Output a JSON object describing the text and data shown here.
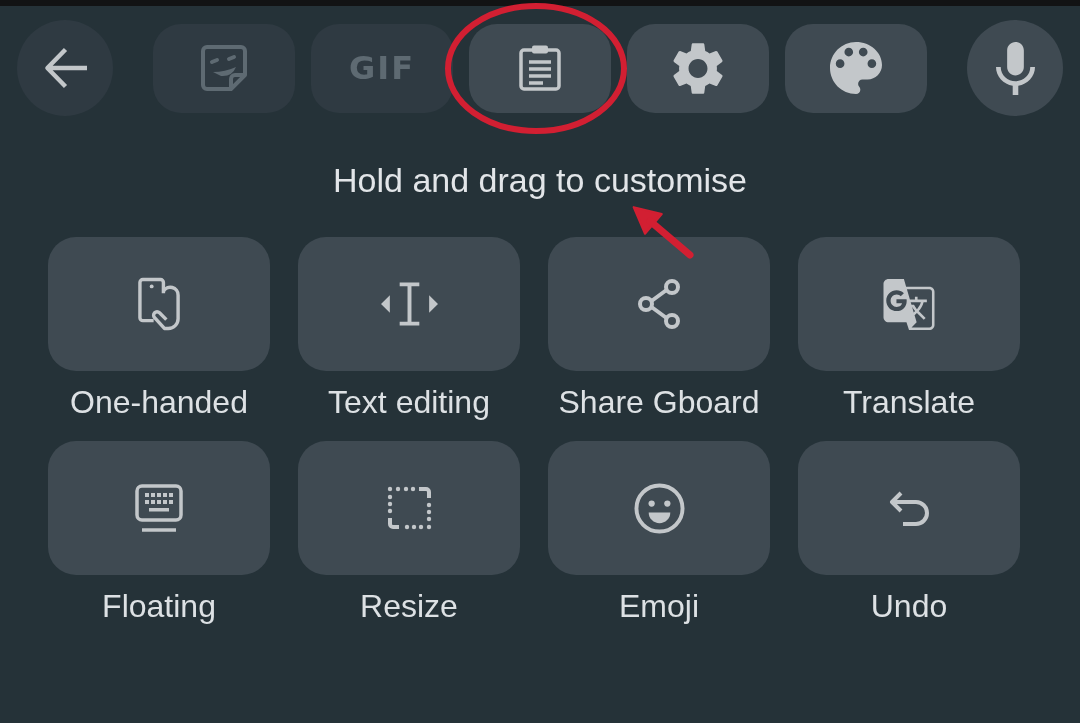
{
  "toolbar": {
    "items": [
      {
        "kind": "back",
        "disabled": false,
        "circled": false
      },
      {
        "kind": "tile",
        "disabled": true,
        "circled": false
      },
      {
        "kind": "tile",
        "label": "GIF",
        "disabled": true,
        "circled": false
      },
      {
        "kind": "tile",
        "disabled": false,
        "circled": true
      },
      {
        "kind": "tile",
        "disabled": false,
        "circled": false
      },
      {
        "kind": "tile",
        "disabled": false,
        "circled": false
      },
      {
        "kind": "round",
        "disabled": false,
        "circled": false
      }
    ]
  },
  "hint": "Hold and drag to customise",
  "tools": [
    {
      "label": "One-handed"
    },
    {
      "label": "Text editing"
    },
    {
      "label": "Share Gboard"
    },
    {
      "label": "Translate"
    },
    {
      "label": "Floating"
    },
    {
      "label": "Resize"
    },
    {
      "label": "Emoji"
    },
    {
      "label": "Undo"
    }
  ]
}
